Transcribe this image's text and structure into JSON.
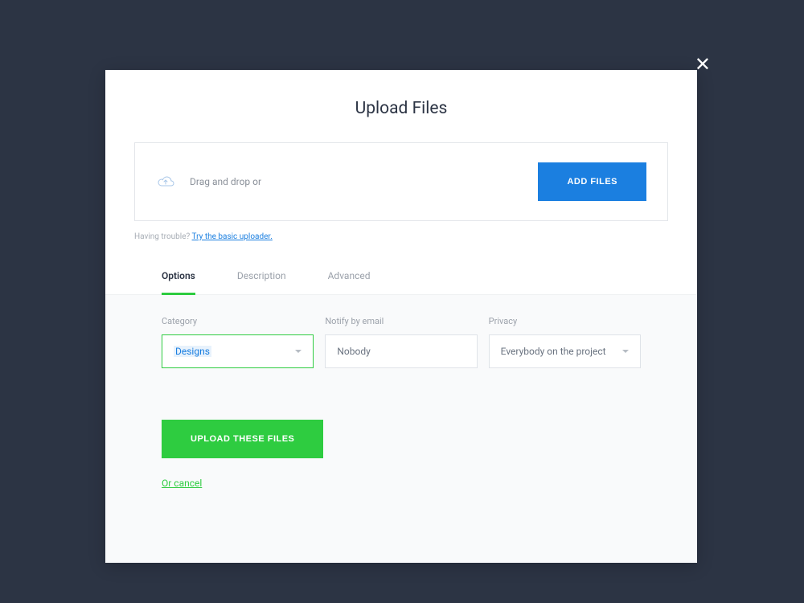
{
  "modal": {
    "title": "Upload Files",
    "close_label": "✕"
  },
  "dropzone": {
    "drag_text": "Drag and drop or",
    "add_files_label": "ADD FILES",
    "cloud_icon": "cloud-upload-icon"
  },
  "help": {
    "prefix": "Having trouble? ",
    "link_text": "Try the basic uploader."
  },
  "tabs": [
    {
      "label": "Options",
      "active": true
    },
    {
      "label": "Description",
      "active": false
    },
    {
      "label": "Advanced",
      "active": false
    }
  ],
  "options": {
    "category": {
      "label": "Category",
      "value": "Designs"
    },
    "notify": {
      "label": "Notify by email",
      "value": "Nobody"
    },
    "privacy": {
      "label": "Privacy",
      "value": "Everybody on the project"
    }
  },
  "actions": {
    "upload_label": "UPLOAD THESE FILES",
    "cancel_label": "Or cancel"
  }
}
